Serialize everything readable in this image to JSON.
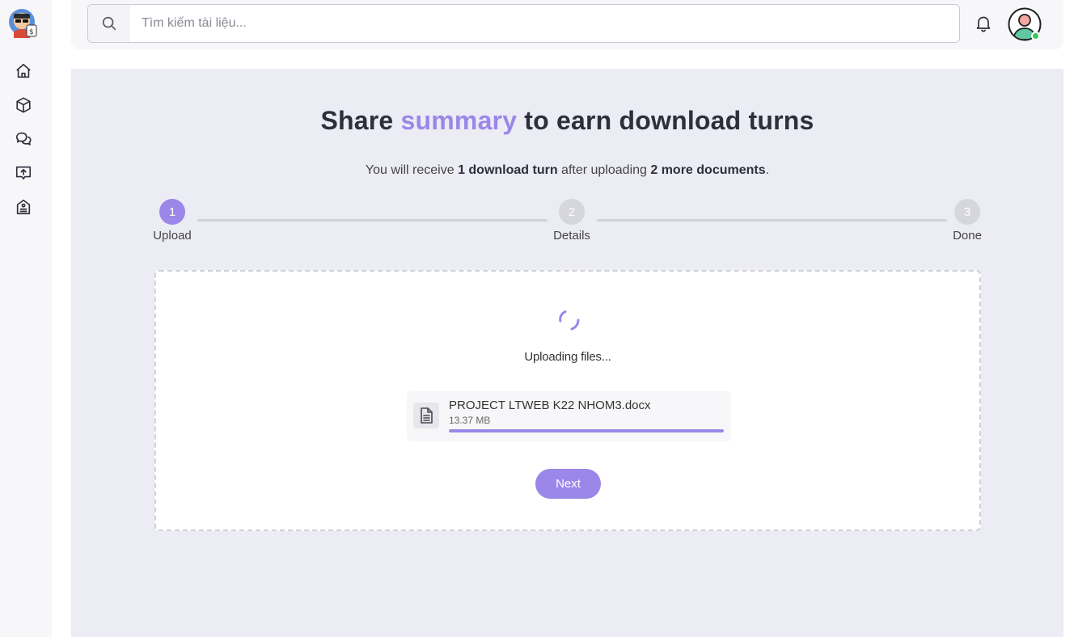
{
  "colors": {
    "accent": "#9b87e8",
    "main_bg": "#ececf5",
    "online": "#34c759"
  },
  "sidebar": {
    "logo_icon": "mascot-logo",
    "items": [
      {
        "name": "home",
        "icon": "home-icon"
      },
      {
        "name": "packages",
        "icon": "cube-icon"
      },
      {
        "name": "chat",
        "icon": "chat-bubbles-icon"
      },
      {
        "name": "upload",
        "icon": "upload-box-icon"
      },
      {
        "name": "organization",
        "icon": "building-icon"
      }
    ]
  },
  "header": {
    "search": {
      "placeholder": "Tìm kiếm tài liệu...",
      "value": ""
    },
    "bell_icon": "bell-icon",
    "avatar_icon": "user-avatar-icon",
    "status": "online"
  },
  "main": {
    "title_prefix": "Share ",
    "title_accent": "summary",
    "title_suffix": " to earn download turns",
    "subtitle": {
      "part1": "You will receive ",
      "bold1": "1 download turn",
      "part2": " after uploading ",
      "bold2": "2 more documents",
      "part3": "."
    },
    "steps": [
      {
        "number": "1",
        "label": "Upload",
        "active": true
      },
      {
        "number": "2",
        "label": "Details",
        "active": false
      },
      {
        "number": "3",
        "label": "Done",
        "active": false
      }
    ],
    "upload": {
      "status_text": "Uploading files...",
      "file": {
        "name": "PROJECT LTWEB K22 NHOM3.docx",
        "size": "13.37 MB",
        "progress_percent": 100,
        "icon": "document-icon"
      },
      "next_label": "Next"
    }
  }
}
